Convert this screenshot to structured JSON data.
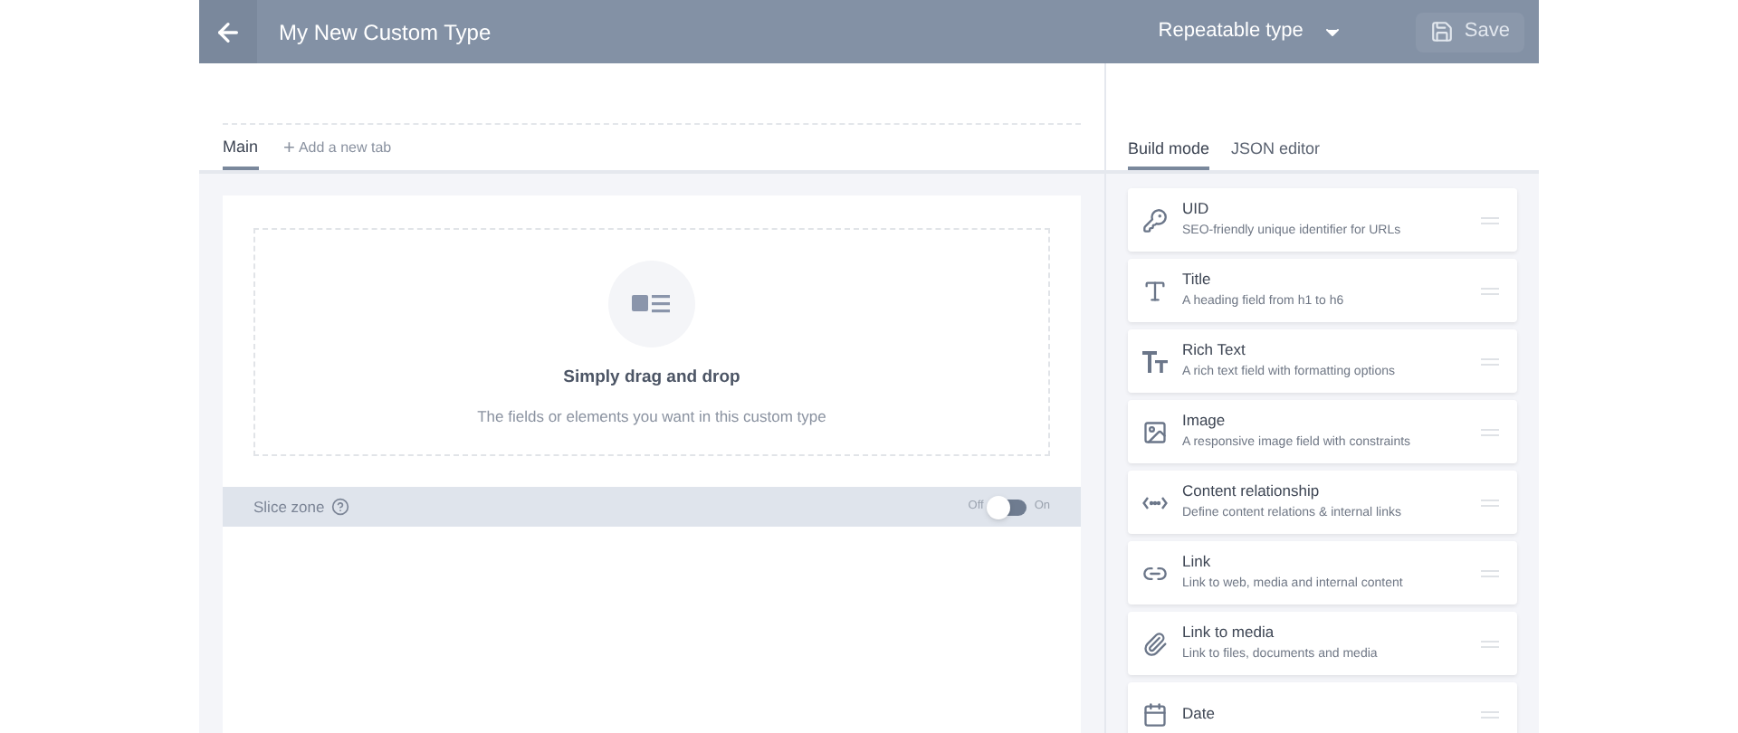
{
  "header": {
    "title": "My New Custom Type",
    "type_select": "Repeatable type",
    "save": {
      "label": "Save",
      "disabled": true
    }
  },
  "tabs": [
    {
      "label": "Main",
      "selected": true
    }
  ],
  "add_tab": {
    "label": "Add a new tab",
    "icon": "+"
  },
  "dropzone": {
    "title": "Simply drag and drop",
    "subtitle": "The fields or elements you want in this custom type"
  },
  "slice_zone": {
    "label": "Slice zone",
    "off_label": "Off",
    "on_label": "On",
    "on": false
  },
  "mode_tabs": [
    {
      "label": "Build mode",
      "selected": true
    },
    {
      "label": "JSON editor",
      "selected": false
    }
  ],
  "fields": [
    {
      "kind": "uid",
      "title": "UID",
      "description": "SEO-friendly unique identifier for URLs"
    },
    {
      "kind": "title",
      "title": "Title",
      "description": "A heading field from h1 to h6"
    },
    {
      "kind": "richtext",
      "title": "Rich Text",
      "description": "A rich text field with formatting options"
    },
    {
      "kind": "image",
      "title": "Image",
      "description": "A responsive image field with constraints"
    },
    {
      "kind": "relation",
      "title": "Content relationship",
      "description": "Define content relations & internal links"
    },
    {
      "kind": "link",
      "title": "Link",
      "description": "Link to web, media and internal content"
    },
    {
      "kind": "media",
      "title": "Link to media",
      "description": "Link to files, documents and media"
    },
    {
      "kind": "date",
      "title": "Date"
    }
  ]
}
